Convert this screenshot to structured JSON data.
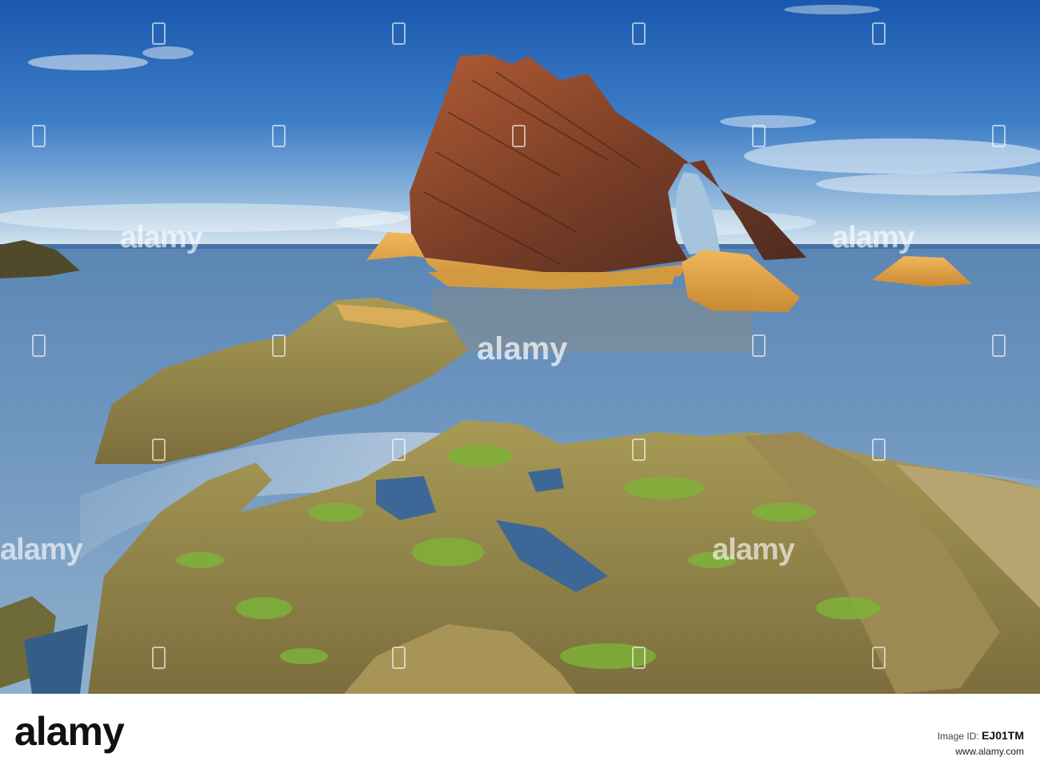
{
  "watermark": {
    "brand": "alamy"
  },
  "footer": {
    "logo": "alamy",
    "image_id_label": "Image ID:",
    "image_id": "EJ01TM",
    "site": "www.alamy.com"
  },
  "colors": {
    "sky_top": "#1d5fb3",
    "sky_bottom": "#cfe0ee",
    "sea": "#4f7fb0",
    "rock_stack": "#8a4a2e",
    "rock_lit": "#e8a94a",
    "moss": "#7ea83a"
  }
}
